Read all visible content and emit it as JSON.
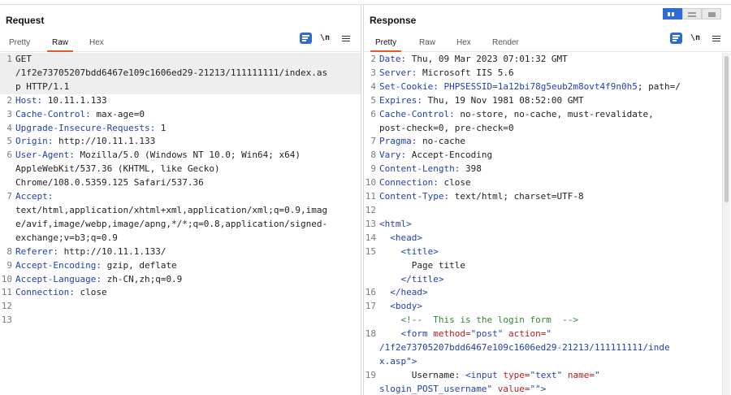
{
  "request": {
    "title": "Request",
    "tabs": [
      "Pretty",
      "Raw",
      "Hex"
    ],
    "active_tab": "Raw",
    "lines": [
      {
        "n": "1",
        "head": "",
        "rest": "GET\n/1f2e73705207bdd6467e109c1606ed29-21213/111111111/index.as\np HTTP/1.1"
      },
      {
        "n": "2",
        "head": "Host:",
        "rest": " 10.11.1.133"
      },
      {
        "n": "3",
        "head": "Cache-Control:",
        "rest": " max-age=0"
      },
      {
        "n": "4",
        "head": "Upgrade-Insecure-Requests:",
        "rest": " 1"
      },
      {
        "n": "5",
        "head": "Origin:",
        "rest": " http://10.11.1.133"
      },
      {
        "n": "6",
        "head": "User-Agent:",
        "rest": " Mozilla/5.0 (Windows NT 10.0; Win64; x64)\nAppleWebKit/537.36 (KHTML, like Gecko)\nChrome/108.0.5359.125 Safari/537.36"
      },
      {
        "n": "7",
        "head": "Accept:",
        "rest": "\ntext/html,application/xhtml+xml,application/xml;q=0.9,imag\ne/avif,image/webp,image/apng,*/*;q=0.8,application/signed-\nexchange;v=b3;q=0.9"
      },
      {
        "n": "8",
        "head": "Referer:",
        "rest": " http://10.11.1.133/"
      },
      {
        "n": "9",
        "head": "Accept-Encoding:",
        "rest": " gzip, deflate"
      },
      {
        "n": "10",
        "head": "Accept-Language:",
        "rest": " zh-CN,zh;q=0.9"
      },
      {
        "n": "11",
        "head": "Connection:",
        "rest": " close"
      },
      {
        "n": "12",
        "head": "",
        "rest": ""
      },
      {
        "n": "13",
        "head": "",
        "rest": ""
      }
    ]
  },
  "response": {
    "title": "Response",
    "tabs": [
      "Pretty",
      "Raw",
      "Hex",
      "Render"
    ],
    "active_tab": "Pretty",
    "header_lines": [
      {
        "n": "2",
        "head": "Date:",
        "rest": " Thu, 09 Mar 2023 07:01:32 GMT"
      },
      {
        "n": "3",
        "head": "Server:",
        "rest": " Microsoft IIS 5.6"
      },
      {
        "n": "4",
        "head": "Set-Cookie:",
        "rest": " ",
        "cookie": "PHPSESSID",
        "cookie_val": "=1a12bi78g5eub2m8ovt4f9n0h5",
        "tail": "; path=/"
      },
      {
        "n": "5",
        "head": "Expires:",
        "rest": " Thu, 19 Nov 1981 08:52:00 GMT"
      },
      {
        "n": "6",
        "head": "Cache-Control:",
        "rest": " no-store, no-cache, must-revalidate,\npost-check=0, pre-check=0"
      },
      {
        "n": "7",
        "head": "Pragma:",
        "rest": " no-cache"
      },
      {
        "n": "8",
        "head": "Vary:",
        "rest": " Accept-Encoding"
      },
      {
        "n": "9",
        "head": "Content-Length:",
        "rest": " 398"
      },
      {
        "n": "10",
        "head": "Connection:",
        "rest": " close"
      },
      {
        "n": "11",
        "head": "Content-Type:",
        "rest": " text/html; charset=UTF-8"
      },
      {
        "n": "12",
        "head": "",
        "rest": ""
      }
    ],
    "html_lines": {
      "l13": {
        "n": "13",
        "tag": "<html>"
      },
      "l14": {
        "n": "14",
        "tag": "<head>"
      },
      "l15": {
        "n": "15",
        "tag": "<title>"
      },
      "l15b": {
        "text": "Page title"
      },
      "l15c": {
        "tag": "</title>"
      },
      "l16": {
        "n": "16",
        "tag": "</head>"
      },
      "l17": {
        "n": "17",
        "tag": "<body>"
      },
      "l17b": {
        "comment": "<!--  This is the login form  -->"
      },
      "l18": {
        "n": "18",
        "tag_open": "<form",
        "attr1": " method=",
        "val1": "\"post\"",
        "attr2": " action=",
        "val2": "\"\n/1f2e73705207bdd6467e109c1606ed29-21213/111111111/inde\nx.asp\"",
        "tag_close": ">"
      },
      "l19": {
        "n": "19",
        "text": "Username: ",
        "tag_open": "<input",
        "attr1": " type=",
        "val1": "\"text\"",
        "attr2": " name=",
        "val2": "\"\nslogin_POST_username\"",
        "attr3": " value=",
        "val3": "\"\"",
        "tag_close": ">"
      }
    }
  }
}
